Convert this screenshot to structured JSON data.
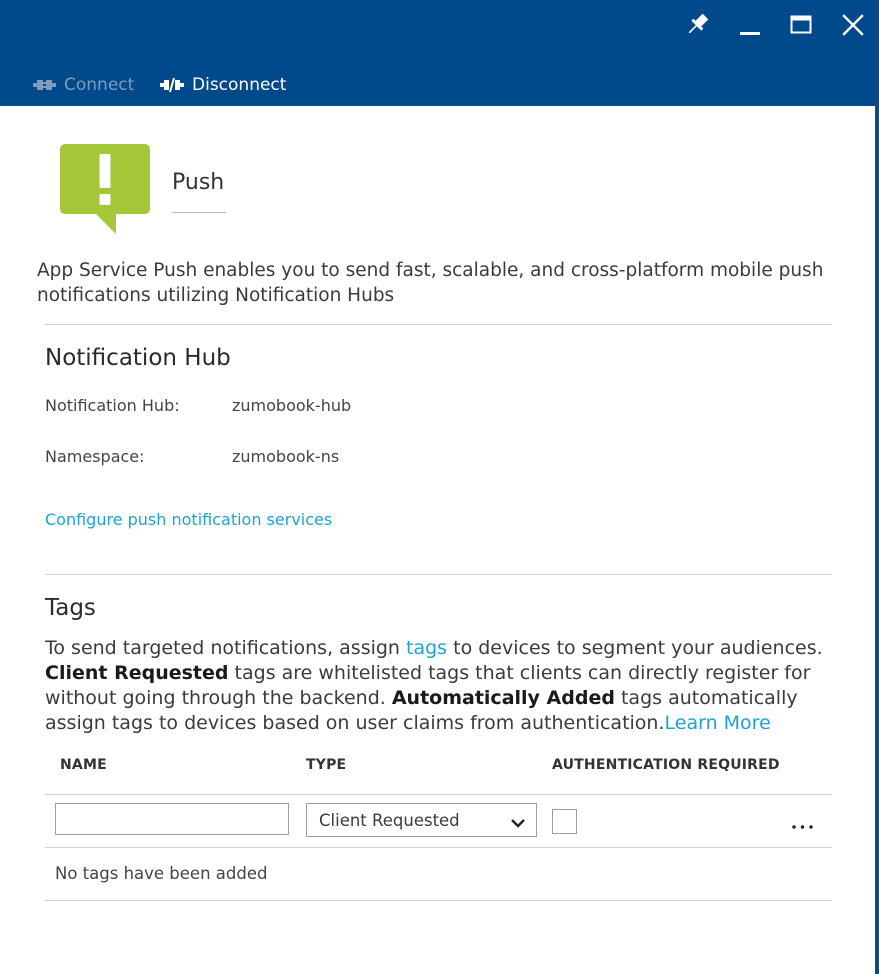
{
  "window": {
    "pin_icon": "pin-icon",
    "minimize_icon": "minimize-icon",
    "maximize_icon": "maximize-icon",
    "close_icon": "close-icon",
    "header_color": "#004a8b"
  },
  "commands": {
    "connect_label": "Connect",
    "disconnect_label": "Disconnect"
  },
  "push": {
    "title": "Push",
    "logo_color": "#a4c639",
    "intro": "App Service Push enables you to send fast, scalable, and cross-platform mobile push notifications utilizing Notification Hubs"
  },
  "notification_hub": {
    "heading": "Notification Hub",
    "hub_label": "Notification Hub:",
    "hub_value": "zumobook-hub",
    "namespace_label": "Namespace:",
    "namespace_value": "zumobook-ns",
    "configure_link": "Configure push notification services"
  },
  "tags": {
    "heading": "Tags",
    "desc_1": "To send targeted notifications, assign ",
    "tags_link": "tags",
    "desc_2": " to devices to segment your audiences. ",
    "client_requested": "Client Requested",
    "desc_3": " tags are whitelisted tags that clients can directly register for without going through the backend. ",
    "automatically_added": "Automatically Added",
    "desc_4": " tags automatically assign tags to devices based on user claims from authentication.",
    "learn_more": "Learn More",
    "columns": [
      "NAME",
      "TYPE",
      "AUTHENTICATION REQUIRED"
    ],
    "name_value": "",
    "type_selected": "Client Requested",
    "auth_required": false,
    "more_label": "...",
    "empty_message": "No tags have been added",
    "link_color": "#1aa4d6"
  }
}
